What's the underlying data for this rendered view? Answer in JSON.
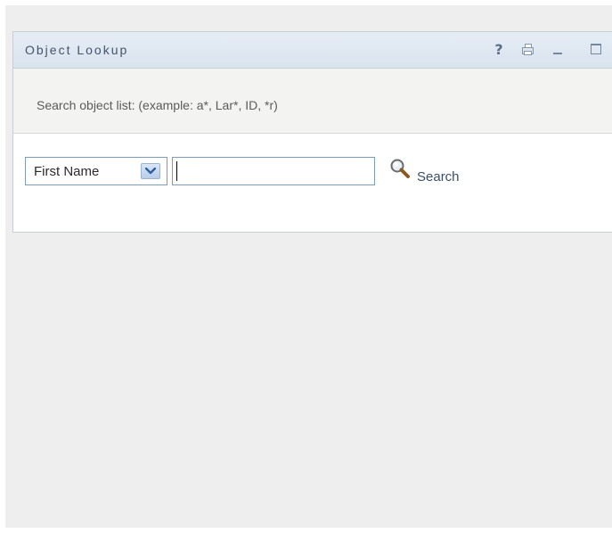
{
  "portlet": {
    "title": "Object Lookup",
    "toolbar": {
      "help_glyph": "?",
      "icons": [
        "help-icon",
        "print-icon",
        "minimize-icon",
        "maximize-icon"
      ]
    }
  },
  "search": {
    "hint": "Search object list: (example: a*, Lar*, ID, *r)",
    "attribute": {
      "selected": "First Name"
    },
    "input_value": "",
    "button_label": "Search"
  }
}
